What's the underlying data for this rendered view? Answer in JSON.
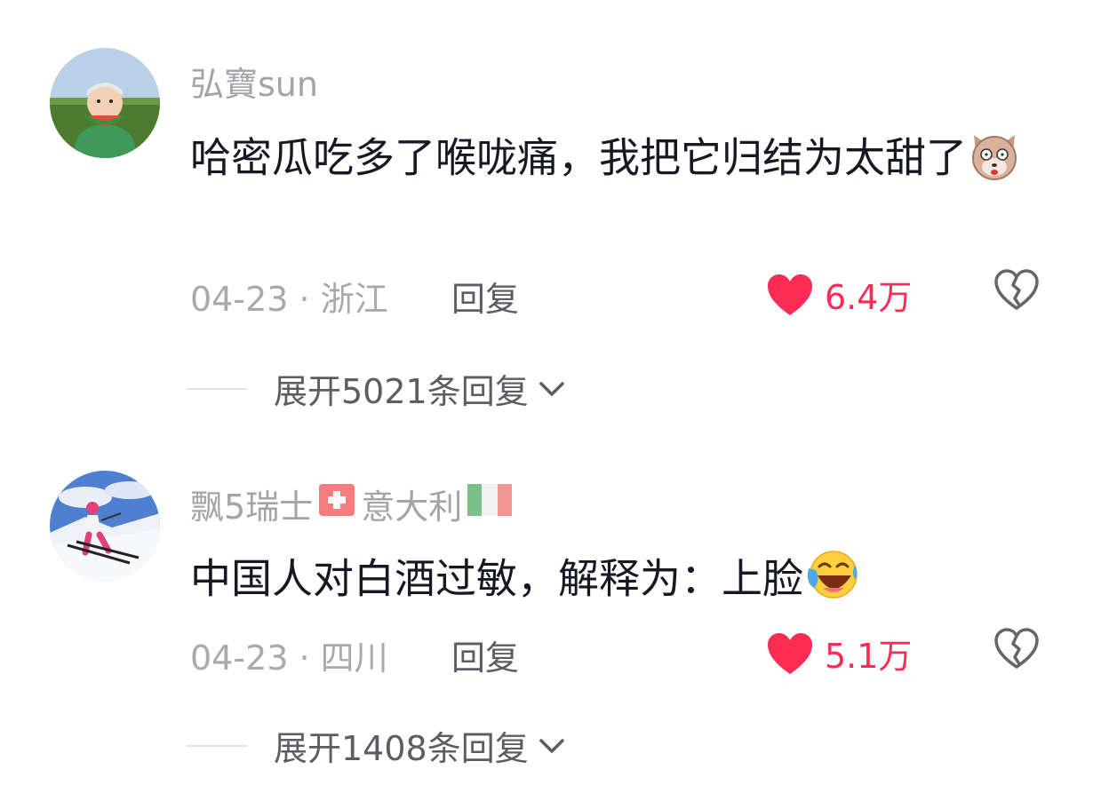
{
  "comments": [
    {
      "username": "弘寶sun",
      "text": "哈密瓜吃多了喉咙痛，我把它归结为太甜了",
      "emoji": "dog-face-emoji",
      "date_location": "04-23 · 浙江",
      "reply_label": "回复",
      "like_count": "6.4万",
      "expand_label": "展开5021条回复"
    },
    {
      "username_part1": "飘5瑞士",
      "username_part2": "意大利",
      "flags": [
        "switzerland-flag",
        "italy-flag"
      ],
      "text": "中国人对白酒过敏，解释为：上脸",
      "emoji": "laughing-tears-emoji",
      "date_location": "04-23 · 四川",
      "reply_label": "回复",
      "like_count": "5.1万",
      "expand_label": "展开1408条回复"
    }
  ],
  "colors": {
    "like_red": "#fe2c55",
    "username_gray": "#a3a3a8",
    "text_dark": "#161823"
  }
}
